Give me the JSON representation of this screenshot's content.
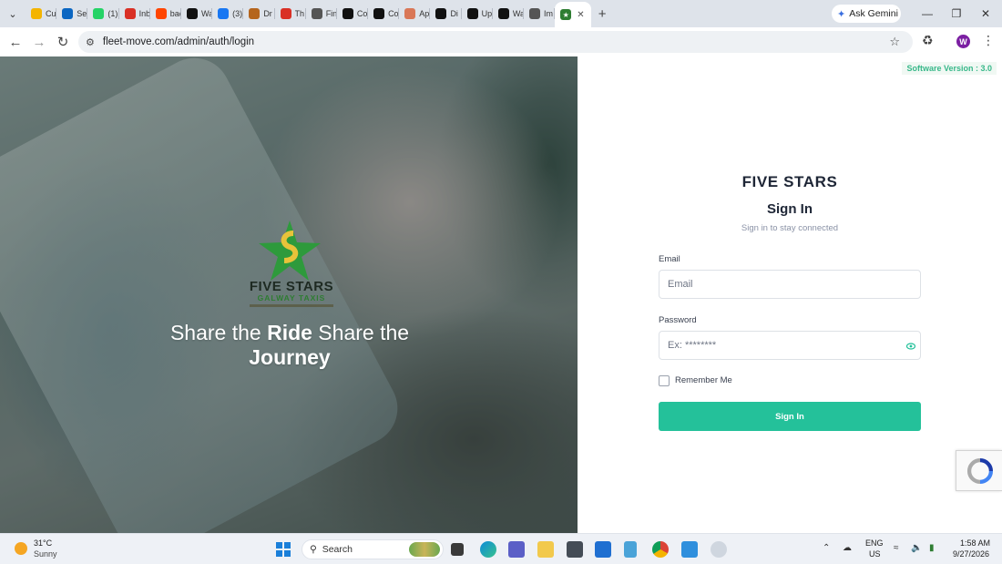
{
  "browser": {
    "tabs": [
      {
        "title": "Cu",
        "icon": "google-drive-icon",
        "color": "#f4b400"
      },
      {
        "title": "Sea",
        "icon": "linkedin-icon",
        "color": "#0a66c2"
      },
      {
        "title": "(1)",
        "icon": "whatsapp-icon",
        "color": "#25d366"
      },
      {
        "title": "Inb",
        "icon": "gmail-icon",
        "color": "#d93025"
      },
      {
        "title": "bac",
        "icon": "reddit-icon",
        "color": "#ff4500"
      },
      {
        "title": "Wa",
        "icon": "threads-icon",
        "color": "#111111"
      },
      {
        "title": "(3)",
        "icon": "facebook-icon",
        "color": "#1877f2"
      },
      {
        "title": "Dr",
        "icon": "eye-icon",
        "color": "#b5651d"
      },
      {
        "title": "Th",
        "icon": "gmail-icon",
        "color": "#d93025"
      },
      {
        "title": "Fin",
        "icon": "openai-icon",
        "color": "#555555"
      },
      {
        "title": "Co",
        "icon": "perplexity-icon",
        "color": "#111111"
      },
      {
        "title": "Co",
        "icon": "perplexity-icon",
        "color": "#111111"
      },
      {
        "title": "Ap",
        "icon": "claude-icon",
        "color": "#d97757"
      },
      {
        "title": "Di",
        "icon": "perplexity-icon",
        "color": "#111111"
      },
      {
        "title": "Up",
        "icon": "upwork-icon",
        "color": "#111111"
      },
      {
        "title": "Wa",
        "icon": "github-icon",
        "color": "#111111"
      },
      {
        "title": "Im",
        "icon": "openai-icon",
        "color": "#555555"
      }
    ],
    "active_tab_icon": "five-stars-favicon",
    "ask_gemini": "Ask Gemini",
    "url": "fleet-move.com/admin/auth/login",
    "profile_initial": "W"
  },
  "hero": {
    "logo_line1": "FIVE STARS",
    "logo_line2": "GALWAY TAXIS",
    "tagline_part1": "Share the ",
    "tagline_bold1": "Ride",
    "tagline_part2": " Share the ",
    "tagline_bold2": "Journey"
  },
  "login": {
    "software_version": "Software Version : 3.0",
    "app_name": "FIVE STARS",
    "title": "Sign In",
    "subtitle": "Sign in to stay connected",
    "email_label": "Email",
    "email_placeholder": "Email",
    "password_label": "Password",
    "password_placeholder": "Ex: ********",
    "remember_label": "Remember Me",
    "submit_label": "Sign In",
    "accent": "#24c19a"
  },
  "taskbar": {
    "weather_temp": "31°C",
    "weather_condition": "Sunny",
    "search_placeholder": "Search",
    "lang_line1": "ENG",
    "lang_line2": "US",
    "time": "1:58 AM",
    "date": "9/27/2026"
  }
}
